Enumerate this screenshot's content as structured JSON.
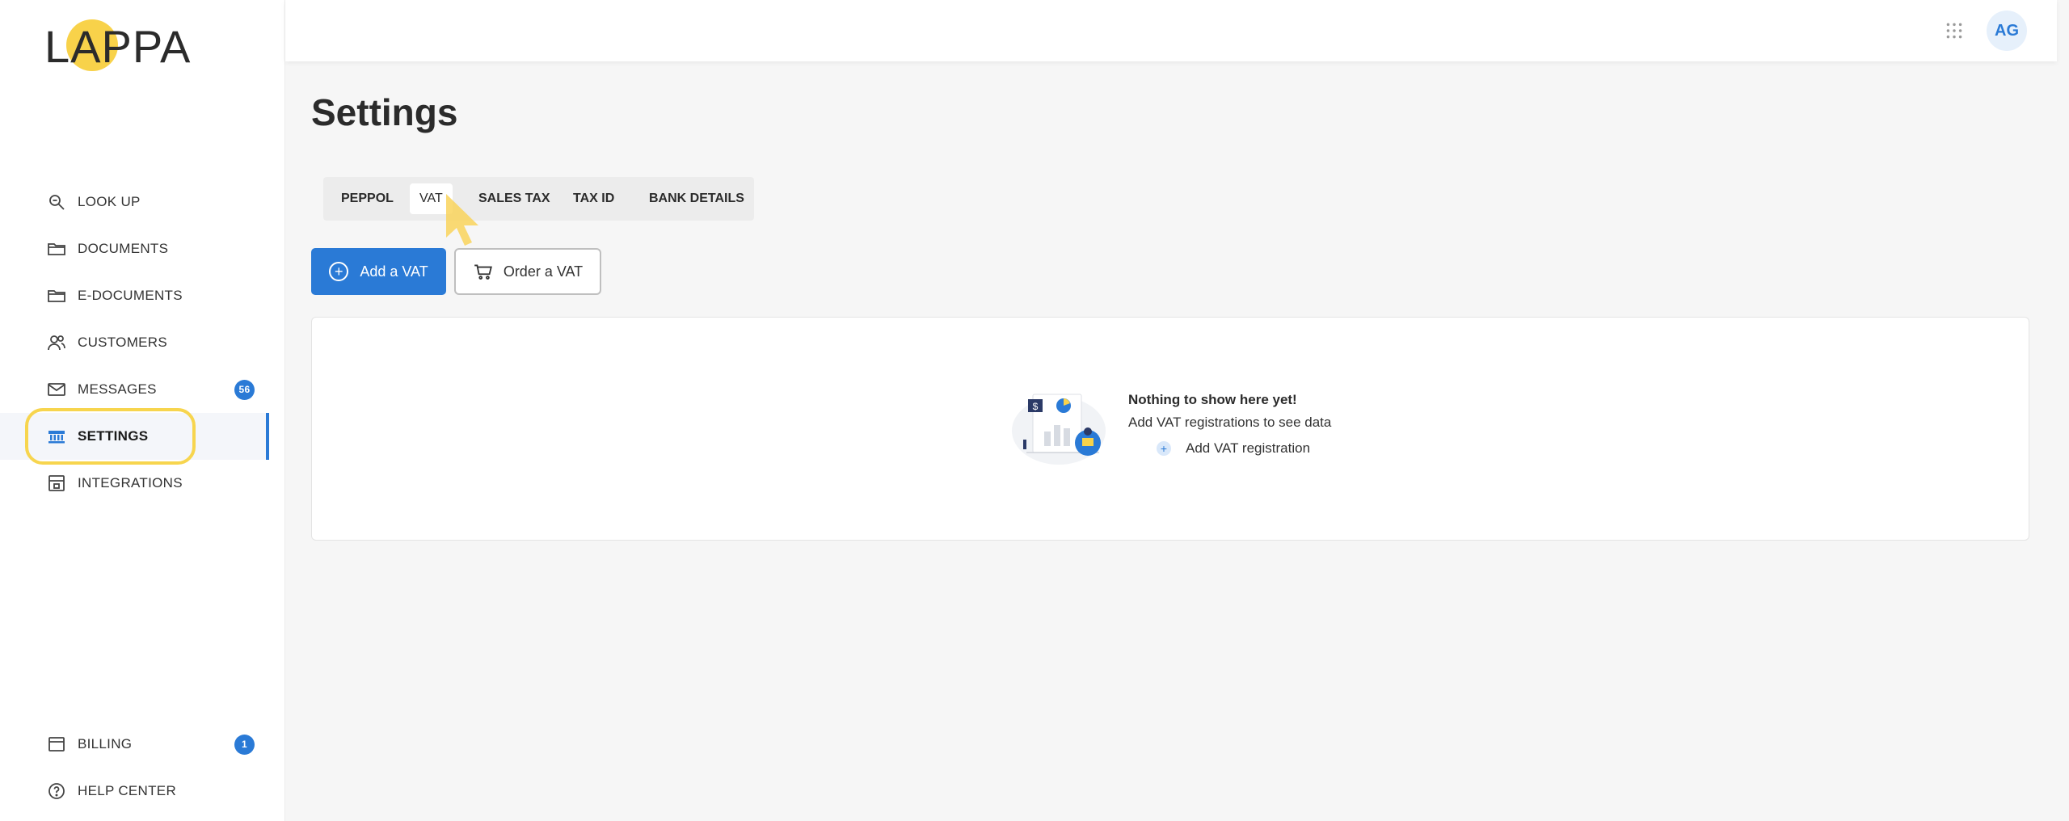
{
  "brand": {
    "logo_text": "LAPPA"
  },
  "sidebar": {
    "items": [
      {
        "label": "LOOK UP",
        "icon": "search-icon"
      },
      {
        "label": "DOCUMENTS",
        "icon": "folder-icon"
      },
      {
        "label": "E-DOCUMENTS",
        "icon": "folder-icon"
      },
      {
        "label": "CUSTOMERS",
        "icon": "users-icon"
      },
      {
        "label": "MESSAGES",
        "icon": "mail-icon",
        "badge": "56"
      },
      {
        "label": "SETTINGS",
        "icon": "bank-icon",
        "active": true
      },
      {
        "label": "INTEGRATIONS",
        "icon": "integrations-icon"
      }
    ],
    "bottom_items": [
      {
        "label": "BILLING",
        "icon": "wallet-icon",
        "badge": "1"
      },
      {
        "label": "HELP CENTER",
        "icon": "help-icon"
      }
    ]
  },
  "topbar": {
    "avatar_initials": "AG",
    "apps_icon": "grid-icon"
  },
  "main": {
    "title": "Settings",
    "tabs": [
      {
        "label": "PEPPOL"
      },
      {
        "label": "VAT",
        "active": true
      },
      {
        "label": "SALES TAX"
      },
      {
        "label": "TAX ID"
      },
      {
        "label": "BANK DETAILS"
      }
    ],
    "actions": {
      "add_label": "Add a VAT",
      "order_label": "Order a VAT"
    },
    "empty_state": {
      "title": "Nothing to show here yet!",
      "subtitle": "Add VAT registrations to see data",
      "link_label": "Add VAT registration"
    }
  },
  "colors": {
    "accent": "#2a7ad6",
    "highlight": "#f7d54e"
  }
}
